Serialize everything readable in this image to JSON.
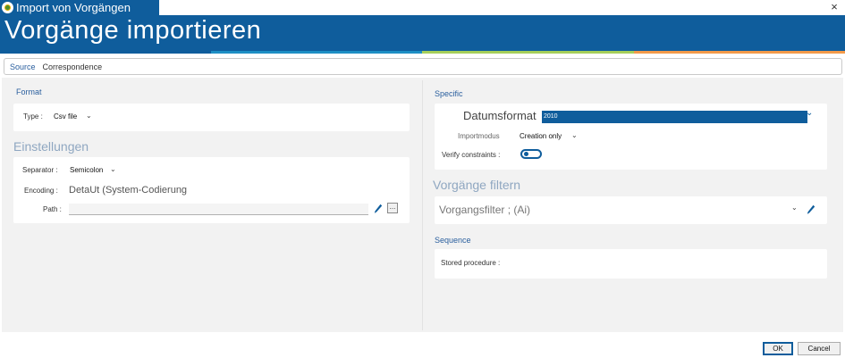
{
  "window": {
    "title": "Import von Vorgängen",
    "close_glyph": "×"
  },
  "header": {
    "title": "Vorgänge importieren",
    "stripe_colors": [
      "#0f5d9c",
      "#1e8fc4",
      "#a6cf5a",
      "#f39a4a"
    ]
  },
  "source": {
    "label": "Source",
    "value": "Correspondence"
  },
  "format": {
    "title": "Format",
    "type_label": "Type :",
    "type_value": "Csv file"
  },
  "einstellungen": {
    "title": "Einstellungen",
    "separator_label": "Separator :",
    "separator_value": "Semicolon",
    "encoding_label": "Encoding :",
    "encoding_value": "DetaUt (System-Codierung",
    "path_label": "Path :",
    "path_value": "",
    "browse_label": "..."
  },
  "specific": {
    "title": "Specific",
    "datumsformat_label": "Datumsformat",
    "datumsformat_value": "2010",
    "importmodus_label": "Importmodus",
    "importmodus_value": "Creation only",
    "verify_label": "Verify constraints :",
    "verify_on": true
  },
  "filter": {
    "title": "Vorgänge filtern",
    "value": "Vorgangsfilter ; (Ai)"
  },
  "sequence": {
    "title": "Sequence",
    "stored_procedure_label": "Stored procedure :"
  },
  "footer": {
    "ok_label": "OK",
    "cancel_label": "Cancel"
  },
  "icons": {
    "dropdown": "chevron-down-icon",
    "edit": "pencil-icon",
    "close": "close-icon"
  }
}
